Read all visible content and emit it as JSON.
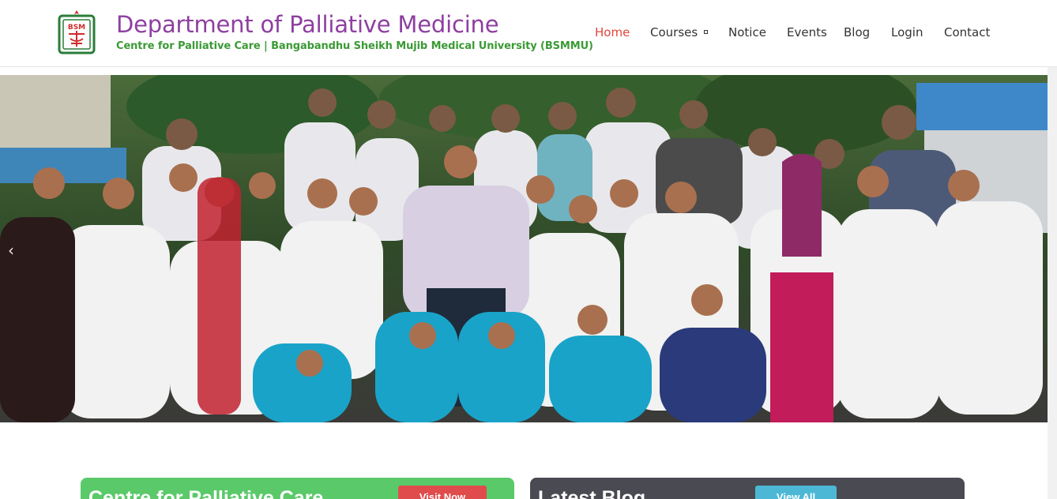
{
  "header": {
    "title": "Department of Palliative Medicine",
    "subtitle": "Centre for Palliative Care | Bangabandhu Sheikh Mujib Medical University (BSMMU)",
    "logo_text": "BSMMU"
  },
  "nav": {
    "items": [
      {
        "label": "Home",
        "active": true
      },
      {
        "label": "Courses",
        "has_dropdown": true
      },
      {
        "label": "Notice"
      },
      {
        "label": "Events"
      },
      {
        "label": "Blog"
      },
      {
        "label": "Login"
      },
      {
        "label": "Contact"
      }
    ]
  },
  "hero": {
    "arrow_left": "‹"
  },
  "panels": {
    "care": {
      "title": "Centre for Palliative Care",
      "button": "Visit Now"
    },
    "blog": {
      "title": "Latest Blog",
      "button": "View All"
    }
  },
  "colors": {
    "title": "#8e3fa0",
    "subtitle": "#3a9a35",
    "nav_active": "#e1443a",
    "panel_green": "#5ac96a",
    "panel_dark": "#4a4a52",
    "btn_red": "#e04c4c",
    "btn_blue": "#4db8d6"
  }
}
